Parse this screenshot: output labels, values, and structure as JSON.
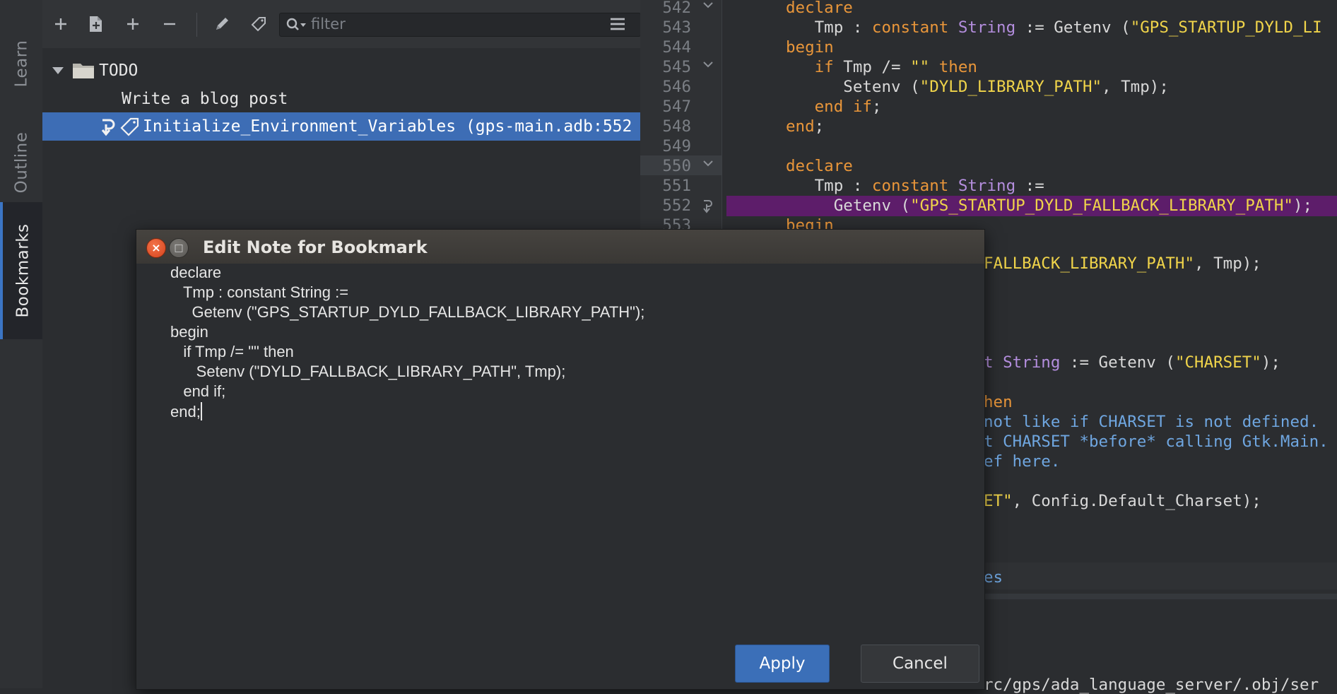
{
  "sidebar": {
    "tabs": [
      {
        "label": "Learn"
      },
      {
        "label": "Outline"
      },
      {
        "label": "Bookmarks"
      }
    ]
  },
  "toolbar": {
    "filter_placeholder": "filter"
  },
  "bookmarks": {
    "group": "TODO",
    "items": [
      {
        "label": "Write a blog post"
      },
      {
        "label": "Initialize_Environment_Variables (gps-main.adb:552"
      }
    ]
  },
  "editor": {
    "line_numbers": [
      "542",
      "543",
      "544",
      "545",
      "546",
      "547",
      "548",
      "549",
      "550",
      "551",
      "552",
      "553"
    ],
    "code": {
      "l542_kw": "declare",
      "l543_a": "   Tmp : ",
      "l543_kw": "constant",
      "l543_ty": "String",
      "l543_b": " := Getenv (",
      "l543_st": "\"GPS_STARTUP_DYLD_LI",
      "l544_kw": "begin",
      "l545_a": "   ",
      "l545_kw1": "if",
      "l545_b": " Tmp /= ",
      "l545_st": "\"\"",
      "l545_kw2": " then",
      "l546_a": "      Setenv (",
      "l546_st": "\"DYLD_LIBRARY_PATH\"",
      "l546_b": ", Tmp);",
      "l547_a": "   ",
      "l547_kw": "end if",
      "l547_b": ";",
      "l548_kw": "end",
      "l548_b": ";",
      "l550_kw": "declare",
      "l551_a": "   Tmp : ",
      "l551_kw": "constant",
      "l551_ty": "String",
      "l551_b": " :=",
      "l552_a": "     Getenv (",
      "l552_st": "\"GPS_STARTUP_DYLD_FALLBACK_LIBRARY_PATH\"",
      "l552_b": ");",
      "l553_kw": "begin",
      "r1_st": "FALLBACK_LIBRARY_PATH\"",
      "r1_b": ", Tmp);",
      "r2_ty": "t String",
      "r2_b": " := Getenv (",
      "r2_st": "\"CHARSET\"",
      "r2_c": ");",
      "r3_kw": "hen",
      "r4_cm": "not like if CHARSET is not defined.",
      "r5_cm": "t CHARSET *before* calling Gtk.Main.",
      "r6_cm": "ef here.",
      "r7_st": "ET\"",
      "r7_b": ", Config.Default_Charset);",
      "r8_cm": "es",
      "r9_b": "rc/gps/ada_language_server/.obj/ser"
    }
  },
  "dialog": {
    "title": "Edit Note for Bookmark",
    "note_lines": [
      "declare",
      "   Tmp : constant String :=",
      "     Getenv (\"GPS_STARTUP_DYLD_FALLBACK_LIBRARY_PATH\");",
      "begin",
      "   if Tmp /= \"\" then",
      "      Setenv (\"DYLD_FALLBACK_LIBRARY_PATH\", Tmp);",
      "   end if;",
      "end;"
    ],
    "apply_label": "Apply",
    "cancel_label": "Cancel"
  }
}
